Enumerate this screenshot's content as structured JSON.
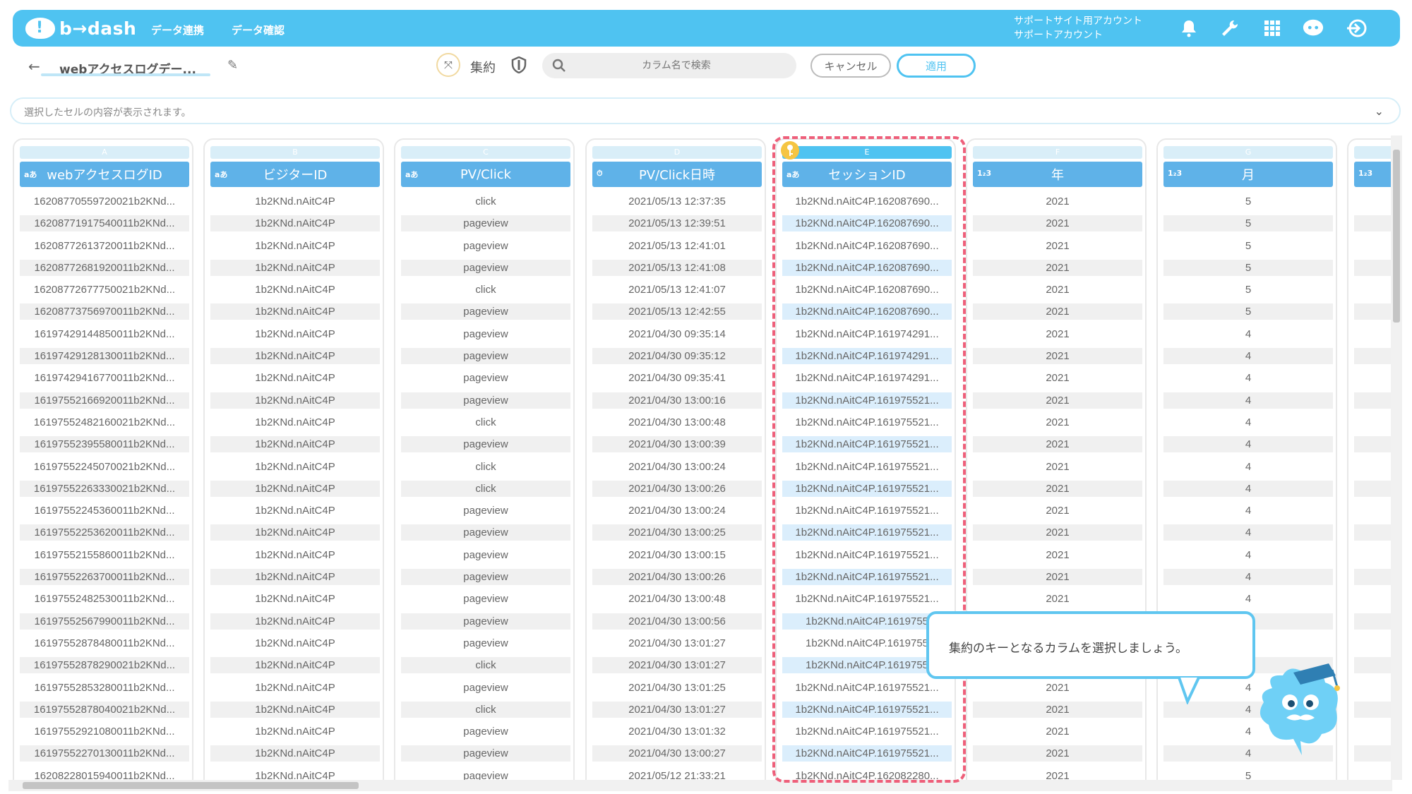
{
  "header": {
    "logo_text": "b→dash",
    "nav": [
      "データ連携",
      "データ確認"
    ],
    "account_line1": "サポートサイト用アカウント",
    "account_line2": "サポートアカウント",
    "icons": [
      "bell-icon",
      "wrench-icon",
      "grid-icon",
      "mascot-icon",
      "logout-icon"
    ],
    "accent_color": "#4fc3f1"
  },
  "toolbar": {
    "back_icon": "←",
    "sheet_name": "webアクセスログデー...",
    "aggregate_label": "集約",
    "search_placeholder": "カラム名で検索",
    "cancel_label": "キャンセル",
    "apply_label": "適用"
  },
  "cellbar": {
    "placeholder": "選択したセルの内容が表示されます。"
  },
  "columns": [
    {
      "letter": "A",
      "type": "aあ",
      "title": "webアクセスログID"
    },
    {
      "letter": "B",
      "type": "aあ",
      "title": "ビジターID"
    },
    {
      "letter": "C",
      "type": "aあ",
      "title": "PV/Click"
    },
    {
      "letter": "D",
      "type": "⏱",
      "title": "PV/Click日時"
    },
    {
      "letter": "E",
      "type": "aあ",
      "title": "セッションID"
    },
    {
      "letter": "F",
      "type": "1₂3",
      "title": "年"
    },
    {
      "letter": "G",
      "type": "1₂3",
      "title": "月"
    },
    {
      "letter": "",
      "type": "1₂3",
      "title": ""
    }
  ],
  "rows": [
    [
      "16208770559720021b2KNd...",
      "1b2KNd.nAitC4P",
      "click",
      "2021/05/13 12:37:35",
      "1b2KNd.nAitC4P.162087690...",
      "2021",
      "5"
    ],
    [
      "16208771917540011b2KNd...",
      "1b2KNd.nAitC4P",
      "pageview",
      "2021/05/13 12:39:51",
      "1b2KNd.nAitC4P.162087690...",
      "2021",
      "5"
    ],
    [
      "16208772613720011b2KNd...",
      "1b2KNd.nAitC4P",
      "pageview",
      "2021/05/13 12:41:01",
      "1b2KNd.nAitC4P.162087690...",
      "2021",
      "5"
    ],
    [
      "16208772681920011b2KNd...",
      "1b2KNd.nAitC4P",
      "pageview",
      "2021/05/13 12:41:08",
      "1b2KNd.nAitC4P.162087690...",
      "2021",
      "5"
    ],
    [
      "16208772677750021b2KNd...",
      "1b2KNd.nAitC4P",
      "click",
      "2021/05/13 12:41:07",
      "1b2KNd.nAitC4P.162087690...",
      "2021",
      "5"
    ],
    [
      "16208773756970011b2KNd...",
      "1b2KNd.nAitC4P",
      "pageview",
      "2021/05/13 12:42:55",
      "1b2KNd.nAitC4P.162087690...",
      "2021",
      "5"
    ],
    [
      "16197429144850011b2KNd...",
      "1b2KNd.nAitC4P",
      "pageview",
      "2021/04/30 09:35:14",
      "1b2KNd.nAitC4P.161974291...",
      "2021",
      "4"
    ],
    [
      "16197429128130011b2KNd...",
      "1b2KNd.nAitC4P",
      "pageview",
      "2021/04/30 09:35:12",
      "1b2KNd.nAitC4P.161974291...",
      "2021",
      "4"
    ],
    [
      "16197429416770011b2KNd...",
      "1b2KNd.nAitC4P",
      "pageview",
      "2021/04/30 09:35:41",
      "1b2KNd.nAitC4P.161974291...",
      "2021",
      "4"
    ],
    [
      "16197552166920011b2KNd...",
      "1b2KNd.nAitC4P",
      "pageview",
      "2021/04/30 13:00:16",
      "1b2KNd.nAitC4P.161975521...",
      "2021",
      "4"
    ],
    [
      "16197552482160021b2KNd...",
      "1b2KNd.nAitC4P",
      "click",
      "2021/04/30 13:00:48",
      "1b2KNd.nAitC4P.161975521...",
      "2021",
      "4"
    ],
    [
      "16197552395580011b2KNd...",
      "1b2KNd.nAitC4P",
      "pageview",
      "2021/04/30 13:00:39",
      "1b2KNd.nAitC4P.161975521...",
      "2021",
      "4"
    ],
    [
      "16197552245070021b2KNd...",
      "1b2KNd.nAitC4P",
      "click",
      "2021/04/30 13:00:24",
      "1b2KNd.nAitC4P.161975521...",
      "2021",
      "4"
    ],
    [
      "16197552263330021b2KNd...",
      "1b2KNd.nAitC4P",
      "click",
      "2021/04/30 13:00:26",
      "1b2KNd.nAitC4P.161975521...",
      "2021",
      "4"
    ],
    [
      "16197552245360011b2KNd...",
      "1b2KNd.nAitC4P",
      "pageview",
      "2021/04/30 13:00:24",
      "1b2KNd.nAitC4P.161975521...",
      "2021",
      "4"
    ],
    [
      "16197552253620011b2KNd...",
      "1b2KNd.nAitC4P",
      "pageview",
      "2021/04/30 13:00:25",
      "1b2KNd.nAitC4P.161975521...",
      "2021",
      "4"
    ],
    [
      "16197552155860011b2KNd...",
      "1b2KNd.nAitC4P",
      "pageview",
      "2021/04/30 13:00:15",
      "1b2KNd.nAitC4P.161975521...",
      "2021",
      "4"
    ],
    [
      "16197552263700011b2KNd...",
      "1b2KNd.nAitC4P",
      "pageview",
      "2021/04/30 13:00:26",
      "1b2KNd.nAitC4P.161975521...",
      "2021",
      "4"
    ],
    [
      "16197552482530011b2KNd...",
      "1b2KNd.nAitC4P",
      "pageview",
      "2021/04/30 13:00:48",
      "1b2KNd.nAitC4P.161975521...",
      "2021",
      "4"
    ],
    [
      "16197552567990011b2KNd...",
      "1b2KNd.nAitC4P",
      "pageview",
      "2021/04/30 13:00:56",
      "1b2KNd.nAitC4P.1619755",
      "",
      ""
    ],
    [
      "16197552878480011b2KNd...",
      "1b2KNd.nAitC4P",
      "pageview",
      "2021/04/30 13:01:27",
      "1b2KNd.nAitC4P.1619755",
      "",
      ""
    ],
    [
      "16197552878290021b2KNd...",
      "1b2KNd.nAitC4P",
      "click",
      "2021/04/30 13:01:27",
      "1b2KNd.nAitC4P.1619755",
      "",
      ""
    ],
    [
      "16197552853280011b2KNd...",
      "1b2KNd.nAitC4P",
      "pageview",
      "2021/04/30 13:01:25",
      "1b2KNd.nAitC4P.161975521...",
      "2021",
      "4"
    ],
    [
      "16197552878040021b2KNd...",
      "1b2KNd.nAitC4P",
      "click",
      "2021/04/30 13:01:27",
      "1b2KNd.nAitC4P.161975521...",
      "2021",
      "4"
    ],
    [
      "16197552921080011b2KNd...",
      "1b2KNd.nAitC4P",
      "pageview",
      "2021/04/30 13:01:32",
      "1b2KNd.nAitC4P.161975521...",
      "2021",
      "4"
    ],
    [
      "16197552270130011b2KNd...",
      "1b2KNd.nAitC4P",
      "pageview",
      "2021/04/30 13:00:27",
      "1b2KNd.nAitC4P.161975521...",
      "2021",
      "4"
    ],
    [
      "16208228015940011b2KNd...",
      "1b2KNd.nAitC4P",
      "pageview",
      "2021/05/12 21:33:21",
      "1b2KNd.nAitC4P.162082280...",
      "2021",
      "5"
    ]
  ],
  "tooltip": {
    "text": "集約のキーとなるカラムを選択しましょう。"
  }
}
